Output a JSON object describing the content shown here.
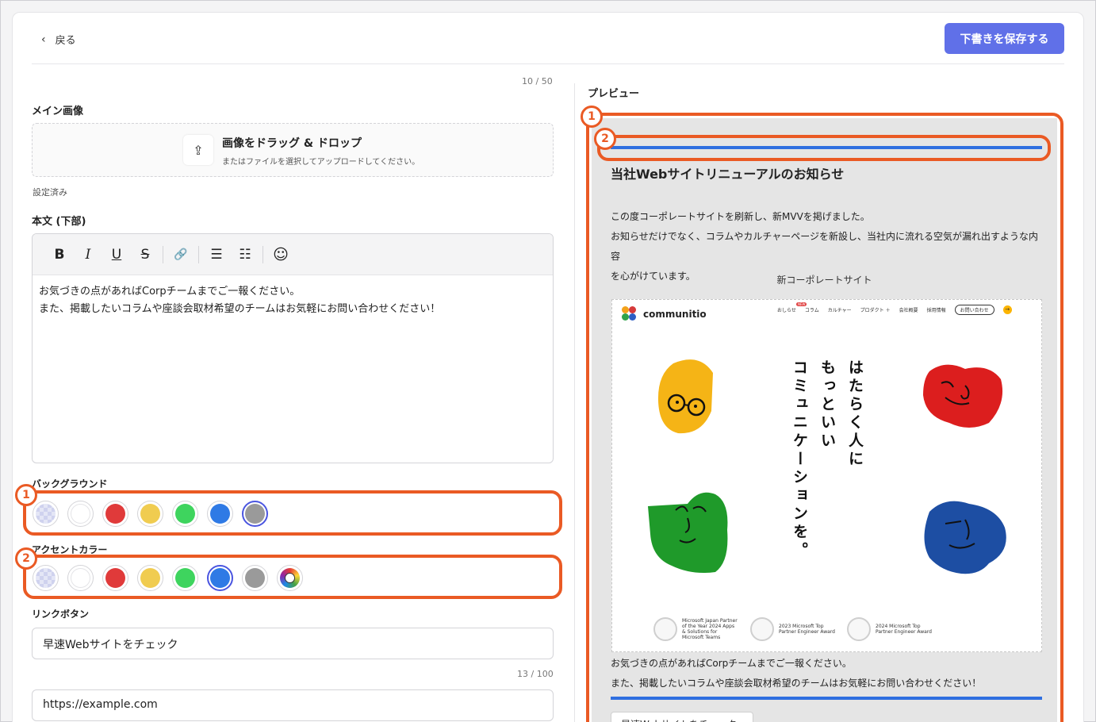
{
  "header": {
    "back_label": "戻る",
    "save_label": "下書きを保存する"
  },
  "form": {
    "title_counter": "10 / 50",
    "main_image_label": "メイン画像",
    "dropzone_title": "画像をドラッグ & ドロップ",
    "dropzone_sub": "またはファイルを選択してアップロードしてください。",
    "image_status": "設定済み",
    "body_label": "本文 (下部)",
    "body_lines": [
      "お気づきの点があればCorpチームまでご一報ください。",
      "また、掲載したいコラムや座談会取材希望のチームはお気軽にお問い合わせください！"
    ],
    "background_label": "バックグラウンド",
    "accent_label": "アクセントカラー",
    "link_button_label": "リンクボタン",
    "link_button_value": "早速Webサイトをチェック",
    "link_counter": "13 / 100",
    "url_value": "https://example.com"
  },
  "toolbar": {
    "bold": "B",
    "italic": "I",
    "underline": "U",
    "strike": "S",
    "link_icon": "🔗",
    "bullet_icon": "☰",
    "numbered_icon": "☷",
    "emoji_icon": "☺"
  },
  "colors": {
    "background": [
      "transparent",
      "#ffffff",
      "#e03a3a",
      "#f0cc50",
      "#3ed45e",
      "#2f7ae5",
      "#9a9a9a"
    ],
    "background_selected": 6,
    "accent": [
      "transparent",
      "#ffffff",
      "#e03a3a",
      "#f0cc50",
      "#3ed45e",
      "#2f7ae5",
      "#9a9a9a",
      "palette"
    ],
    "accent_selected": 5,
    "highlight": "#ea5a24",
    "primary_button": "#6070e8"
  },
  "annotations": {
    "one": "1",
    "two": "2"
  },
  "preview": {
    "label": "プレビュー",
    "title": "当社Webサイトリニューアルのお知らせ",
    "body_lines": [
      "この度コーポレートサイトを刷新し、新MVVを掲げました。",
      "お知らせだけでなく、コラムやカルチャーページを新設し、当社内に流れる空気が漏れ出すような内容",
      "を心がけています。"
    ],
    "image_caption": "新コーポレートサイト",
    "site": {
      "logo": "communitio",
      "nav": [
        "おしらせ",
        "コラム",
        "カルチャー",
        "プロダクト ＋",
        "会社概要",
        "採用情報"
      ],
      "nav_new": "NEW",
      "contact": "お問い合わせ",
      "headline_col1": "はたらく人に",
      "headline_col2": "もっといい",
      "headline_col3": "コミュニケーションを。",
      "awards": [
        "Microsoft Japan Partner of the Year 2024 Apps & Solutions for Microsoft Teams",
        "2023 Microsoft Top Partner Engineer Award",
        "2024 Microsoft Top Partner Engineer Award"
      ]
    },
    "footer_lines": [
      "お気づきの点があればCorpチームまでご一報ください。",
      "また、掲載したいコラムや座談会取材希望のチームはお気軽にお問い合わせください！"
    ],
    "button_label": "早速Webサイトをチェック"
  }
}
